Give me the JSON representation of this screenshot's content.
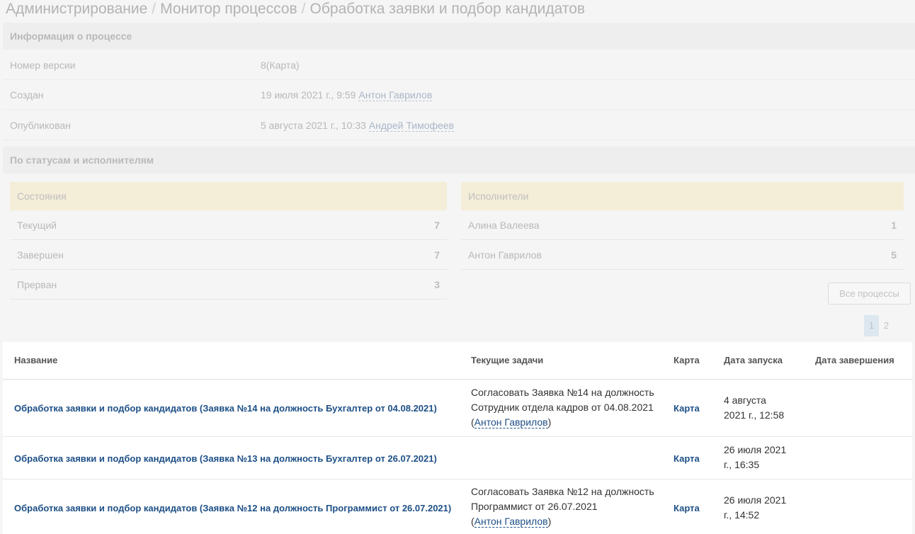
{
  "breadcrumb": {
    "items": [
      "Администрирование",
      "Монитор процессов",
      "Обработка заявки и подбор кандидатов"
    ],
    "separator": "/"
  },
  "process_info": {
    "title": "Информация о процессе",
    "version_label": "Номер версии",
    "version_value": "8(Карта)",
    "created_label": "Создан",
    "created_date": "19 июля 2021 г., 9:59",
    "created_user": "Антон Гаврилов",
    "published_label": "Опубликован",
    "published_date": "5 августа 2021 г., 10:33",
    "published_user": "Андрей Тимофеев"
  },
  "status_section": {
    "title": "По статусам и исполнителям",
    "states_header": "Состояния",
    "states": [
      {
        "label": "Текущий",
        "count": "7"
      },
      {
        "label": "Завершен",
        "count": "7"
      },
      {
        "label": "Прерван",
        "count": "3"
      }
    ],
    "executors_header": "Исполнители",
    "executors": [
      {
        "label": "Алина Валеева",
        "count": "1"
      },
      {
        "label": "Антон Гаврилов",
        "count": "5"
      }
    ],
    "all_processes_button": "Все процессы"
  },
  "pagination": {
    "pages": [
      "1",
      "2"
    ],
    "active": "1"
  },
  "table": {
    "columns": {
      "name": "Название",
      "tasks": "Текущие задачи",
      "map": "Карта",
      "start": "Дата запуска",
      "end": "Дата завершения"
    },
    "rows": [
      {
        "name": "Обработка заявки и подбор кандидатов (Заявка №14 на должность Бухгалтер от 04.08.2021)",
        "task_line1": "Согласовать Заявка №14 на должность",
        "task_line2": "Сотрудник отдела кадров от 04.08.2021",
        "task_user": "Антон Гаврилов",
        "map": "Карта",
        "start_line1": "4 августа",
        "start_line2": "2021 г., 12:58",
        "end": ""
      },
      {
        "name": "Обработка заявки и подбор кандидатов (Заявка №13 на должность Бухгалтер от 26.07.2021)",
        "task_line1": "",
        "task_line2": "",
        "task_user": "",
        "map": "Карта",
        "start_line1": "26 июля 2021",
        "start_line2": "г., 16:35",
        "end": ""
      },
      {
        "name": "Обработка заявки и подбор кандидатов (Заявка №12 на должность Программист от 26.07.2021)",
        "task_line1": "Согласовать Заявка №12 на должность",
        "task_line2": "Программист от 26.07.2021",
        "task_user": "Антон Гаврилов",
        "map": "Карта",
        "start_line1": "26 июля 2021",
        "start_line2": "г., 14:52",
        "end": ""
      }
    ]
  }
}
